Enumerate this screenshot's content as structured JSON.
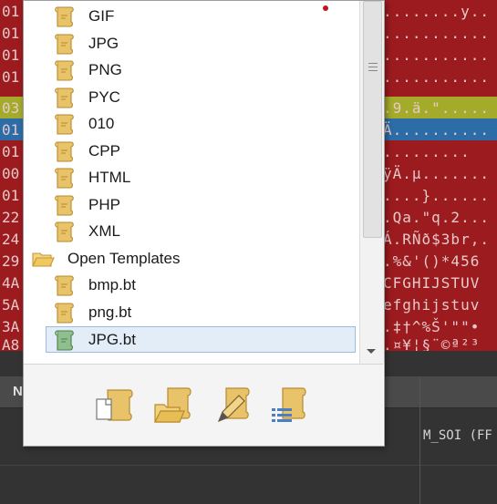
{
  "hex": {
    "offsets": [
      "01",
      "01",
      "01",
      "01",
      "03",
      "01",
      "01",
      "00",
      "01",
      "22",
      "24",
      "29",
      "4A",
      "5A",
      "3A",
      "A8"
    ],
    "ascii": [
      "........y..",
      "...........",
      "...........",
      "...........",
      ".9.ä.\".....",
      "Ä..........",
      ".........",
      "ÿÄ.µ.......",
      "....}......",
      ".Qa.\"q.2...",
      "Á.RÑð$3br,.",
      ".%&'()*456",
      "CFGHIJSTUV",
      "efghijstuv",
      ".‡†^%Š'\"\"•",
      ".¤¥¦§¨©ª²³"
    ]
  },
  "popup": {
    "items": [
      {
        "label": "GIF",
        "kind": "template"
      },
      {
        "label": "JPG",
        "kind": "template"
      },
      {
        "label": "PNG",
        "kind": "template"
      },
      {
        "label": "PYC",
        "kind": "template"
      },
      {
        "label": "010",
        "kind": "template"
      },
      {
        "label": "CPP",
        "kind": "template"
      },
      {
        "label": "HTML",
        "kind": "template"
      },
      {
        "label": "PHP",
        "kind": "template"
      },
      {
        "label": "XML",
        "kind": "template"
      },
      {
        "label": "Open Templates",
        "kind": "folder"
      },
      {
        "label": "bmp.bt",
        "kind": "template"
      },
      {
        "label": "png.bt",
        "kind": "template"
      },
      {
        "label": "JPG.bt",
        "kind": "template-selected"
      }
    ],
    "toolbar": [
      "new-template-icon",
      "open-template-icon",
      "edit-template-icon",
      "template-list-icon"
    ]
  },
  "lower": {
    "header_n": "N",
    "cell_value": "M_SOI (FF"
  },
  "colors": {
    "hex_bg": "#9c1b1f",
    "selection": "#e3edf8",
    "icon_parchment": "#e8c36a"
  }
}
